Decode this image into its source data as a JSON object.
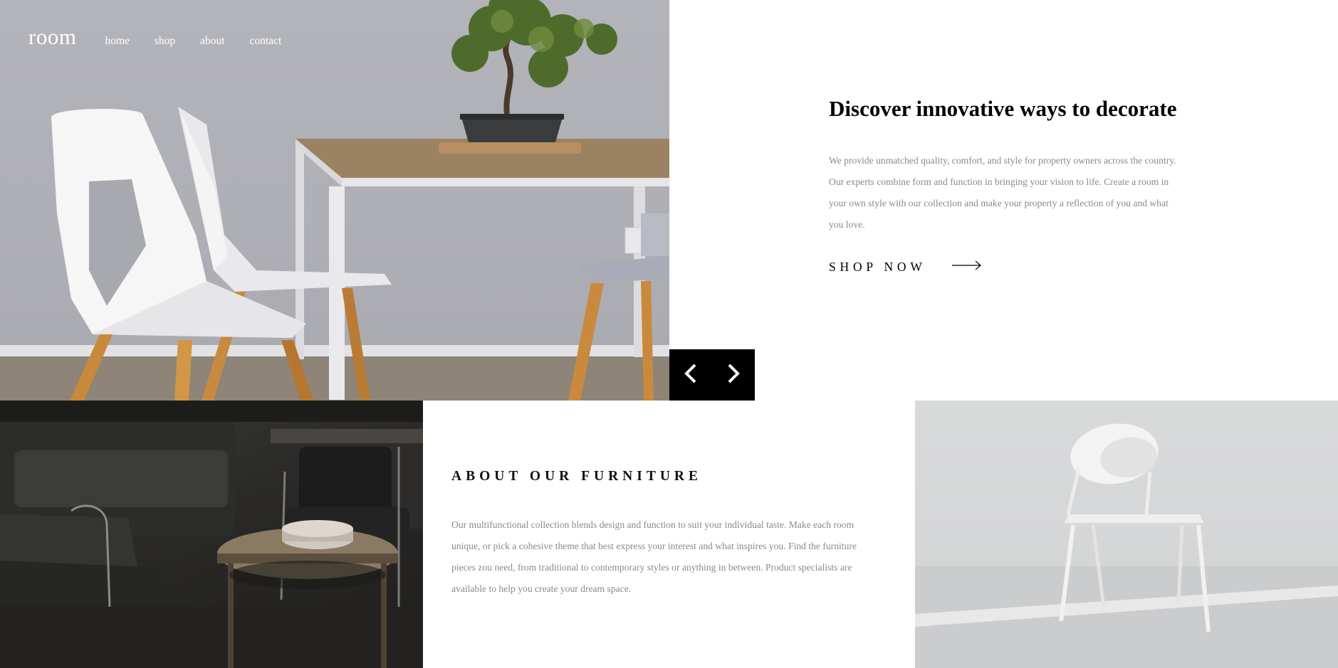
{
  "brand": {
    "logo": "room"
  },
  "nav": {
    "items": [
      "home",
      "shop",
      "about",
      "contact"
    ]
  },
  "hero": {
    "title": "Discover innovative ways to decorate",
    "body": "We provide unmatched quality, comfort, and style for property owners across the country. Our experts combine form and function in bringing your vision to life. Create a room in your own style with our collection and make your property a reflection of you and what you love.",
    "cta_label": "SHOP NOW"
  },
  "slider": {
    "prev_icon": "chevron-left-icon",
    "next_icon": "chevron-right-icon"
  },
  "about": {
    "title": "ABOUT OUR FURNITURE",
    "body": "Our multifunctional collection blends design and function to suit your individual taste. Make each room unique, or pick a cohesive theme that best express your interest and what inspires you. Find the furniture pieces zou need, from traditional to contemporary styles or anything in between. Product specialists are available to help you create your dream space."
  },
  "images": {
    "hero": "dining-table-chairs-bonsai-photo",
    "about_left": "dark-living-room-armchairs-photo",
    "about_right": "white-chair-photo"
  },
  "colors": {
    "text": "#000000",
    "muted": "#8a8a8a",
    "slider_bg": "#000000",
    "background": "#ffffff"
  }
}
